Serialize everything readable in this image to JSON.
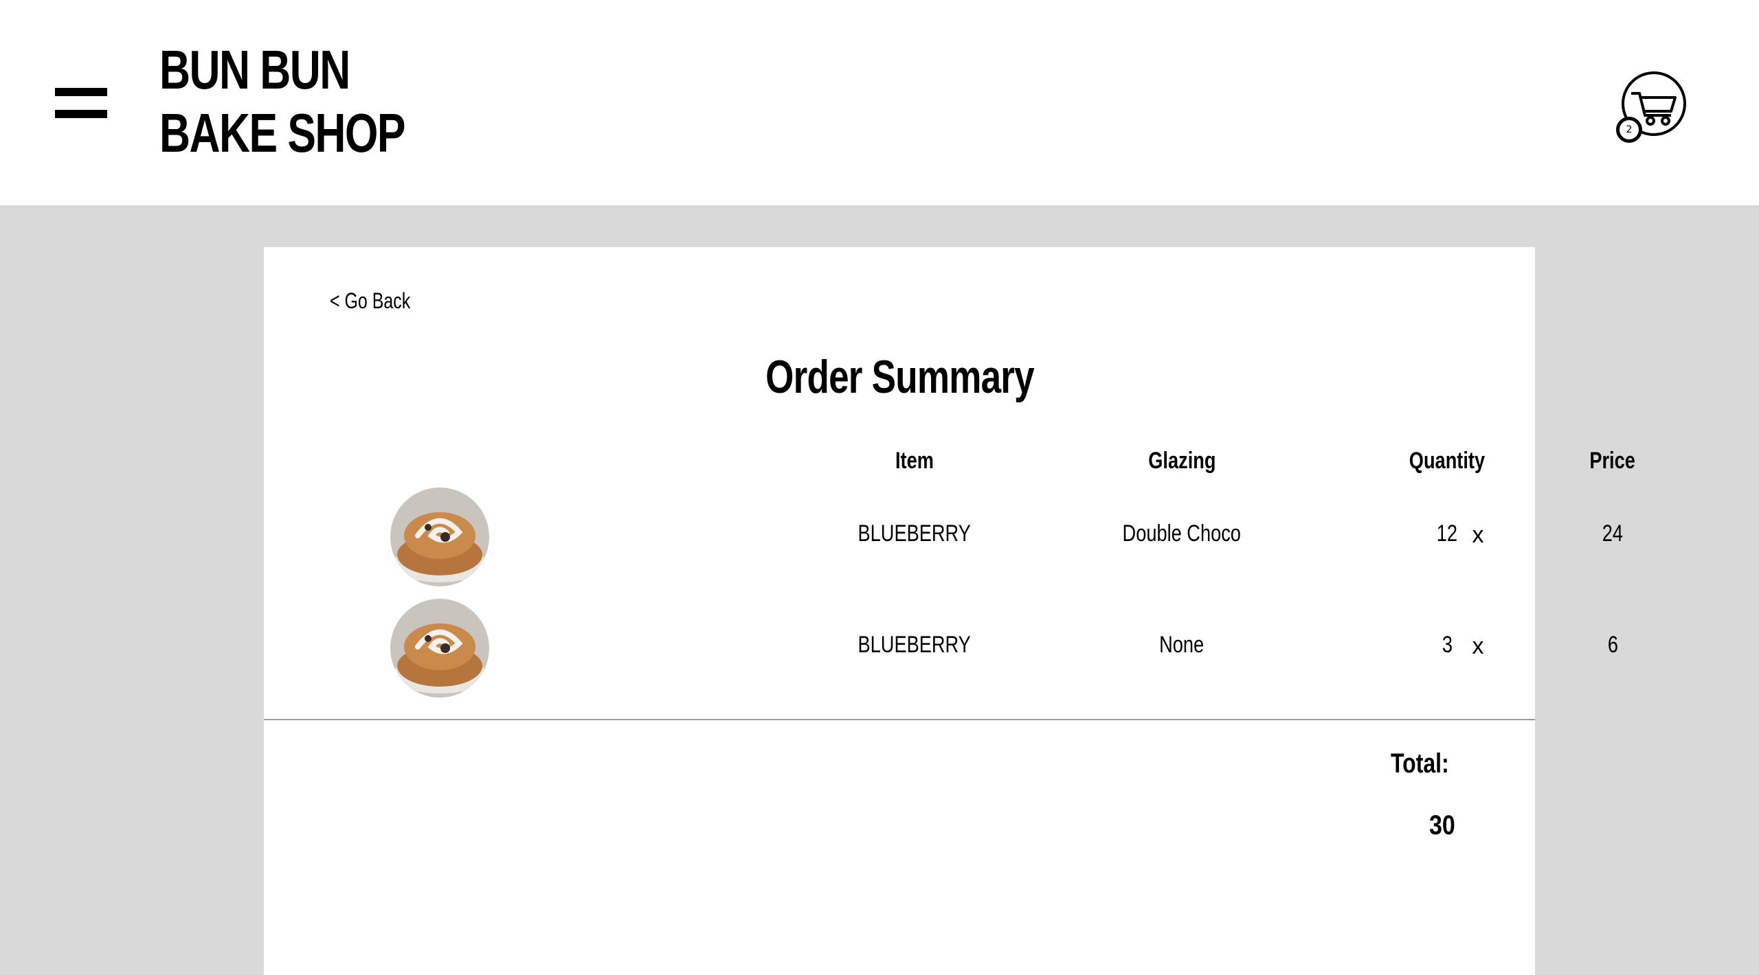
{
  "header": {
    "logo_line1": "BUN BUN",
    "logo_line2": "BAKE SHOP",
    "menu_icon": "hamburger-icon",
    "cart_icon": "shopping-cart-icon",
    "cart_count": "2"
  },
  "page": {
    "go_back": "< Go Back",
    "title": "Order Summary"
  },
  "table": {
    "headers": {
      "item": "Item",
      "glazing": "Glazing",
      "quantity": "Quantity",
      "price": "Price"
    },
    "rows": [
      {
        "item": "BLUEBERRY",
        "glazing": "Double Choco",
        "quantity": "12",
        "price": "24",
        "remove": "x"
      },
      {
        "item": "BLUEBERRY",
        "glazing": "None",
        "quantity": "3",
        "price": "6",
        "remove": "x"
      }
    ]
  },
  "summary": {
    "total_label": "Total:",
    "total_value": "30"
  },
  "colors": {
    "background": "#d9d9d9",
    "card": "#ffffff",
    "text": "#000000"
  }
}
